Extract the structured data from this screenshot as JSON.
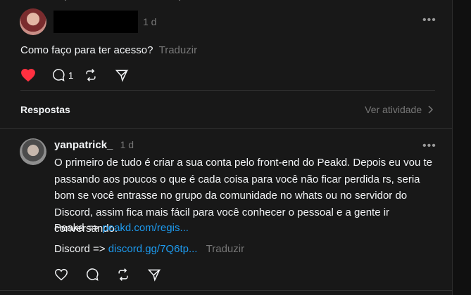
{
  "post": {
    "time": "1 d",
    "text": "Como faço para ter acesso?",
    "translate": "Traduzir",
    "reply_count": "1"
  },
  "replies_header": {
    "title": "Respostas",
    "activity": "Ver atividade"
  },
  "reply": {
    "username": "yanpatrick_",
    "time": "1 d",
    "body": "O primeiro de tudo é criar a sua conta pelo front-end do Peakd. Depois eu vou te passando aos poucos o que é cada coisa para você não ficar perdida rs, seria bom se você entrasse no grupo da comunidade no whats ou no servidor do Discord, assim fica mais fácil para você conhecer o pessoal e a gente ir conversando.",
    "peakd_label": "Peakd =>",
    "peakd_link": "peakd.com/regis...",
    "discord_label": "Discord =>",
    "discord_link": "discord.gg/7Q6tp...",
    "translate": "Traduzir"
  },
  "colors": {
    "background": "#181818",
    "like_active": "#ff3040",
    "link": "#1d9bf0"
  }
}
